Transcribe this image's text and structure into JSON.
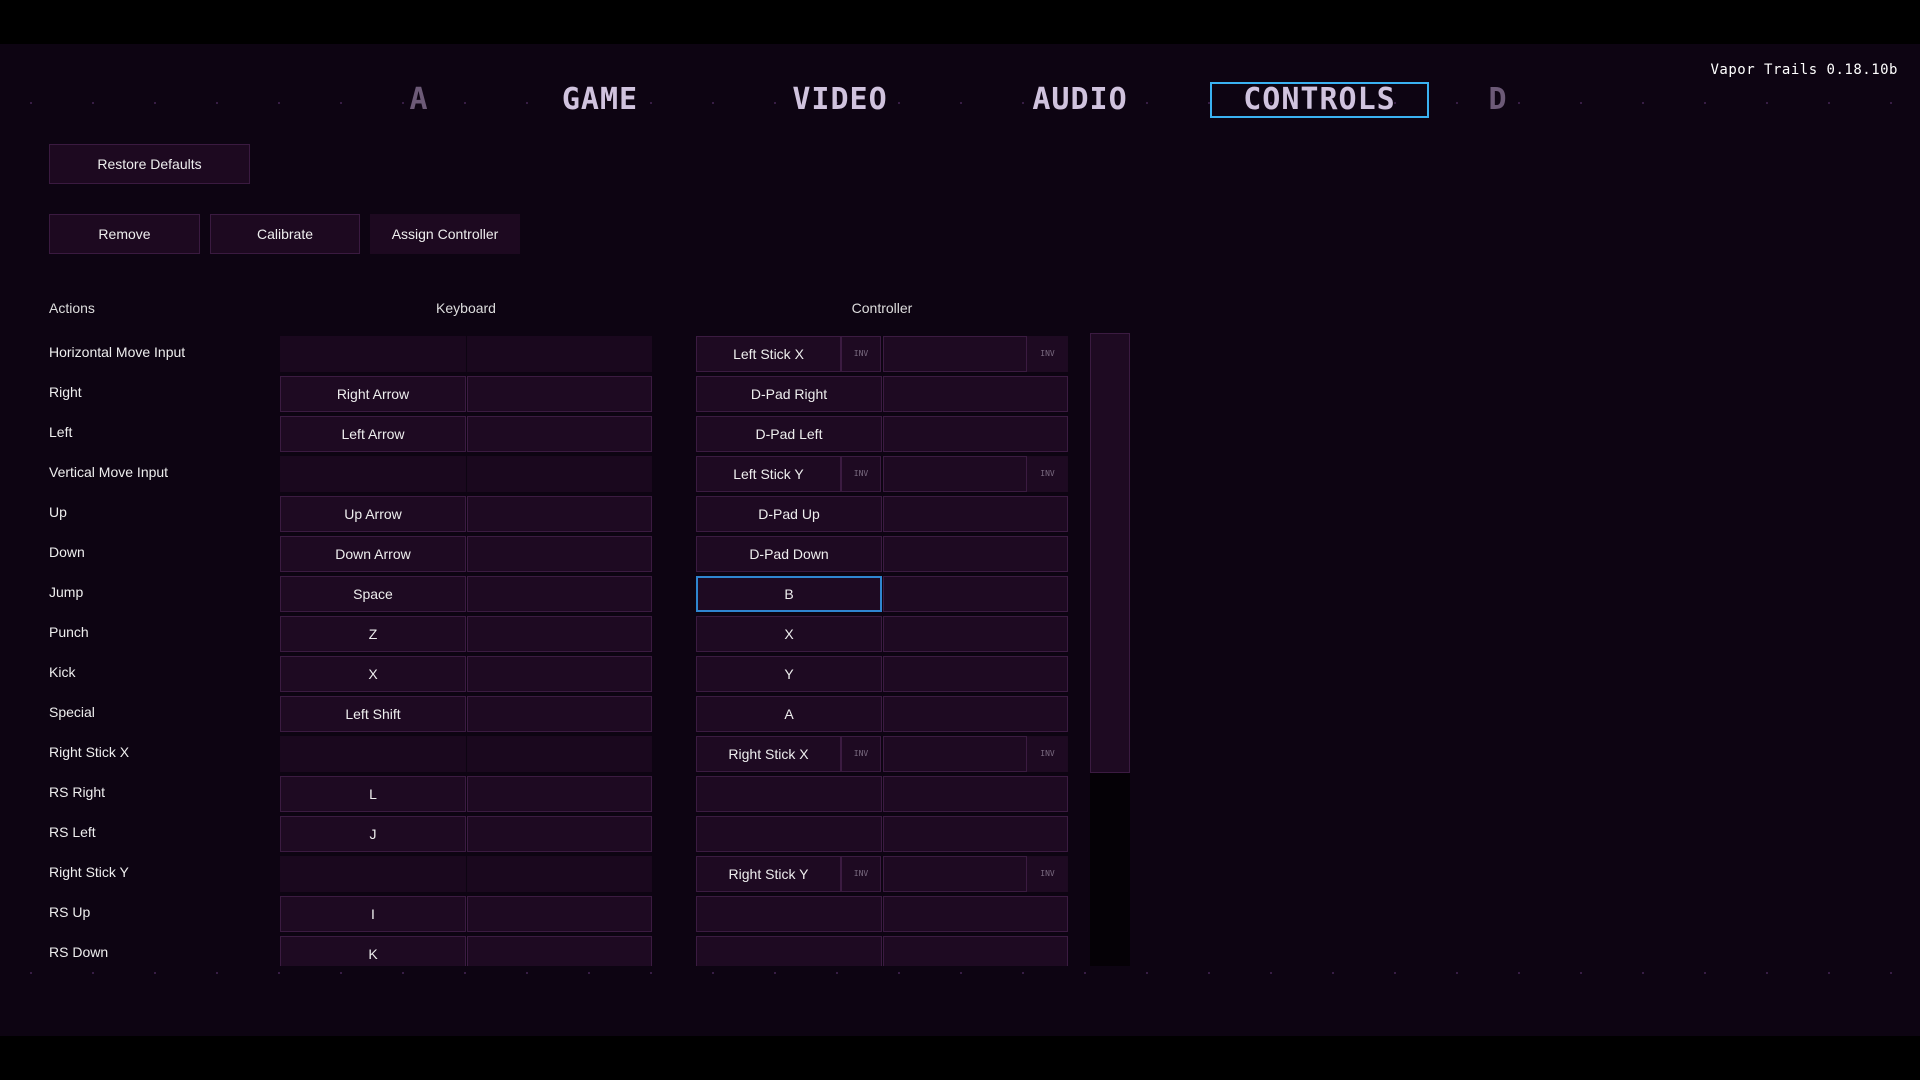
{
  "version": "Vapor Trails 0.18.10b",
  "tabs": [
    {
      "label": "A",
      "state": "dim"
    },
    {
      "label": "GAME",
      "state": "normal"
    },
    {
      "label": "VIDEO",
      "state": "normal"
    },
    {
      "label": "AUDIO",
      "state": "normal"
    },
    {
      "label": "CONTROLS",
      "state": "active"
    },
    {
      "label": "D",
      "state": "dim"
    }
  ],
  "buttons": {
    "restore": "Restore Defaults",
    "remove": "Remove",
    "calibrate": "Calibrate",
    "assign": "Assign Controller"
  },
  "headers": {
    "actions": "Actions",
    "keyboard": "Keyboard",
    "controller": "Controller"
  },
  "inv_label": "INV",
  "colors": {
    "accent": "#3ab2f2",
    "background": "#0d0412",
    "cell": "#1e0a22"
  },
  "scrollbar": {
    "visible_fraction": 0.7,
    "position": 0
  },
  "rows": [
    {
      "action": "Horizontal Move Input",
      "keyboard": [
        "",
        ""
      ],
      "controller": [
        "Left Stick X",
        ""
      ],
      "axis": true
    },
    {
      "action": "Right",
      "keyboard": [
        "Right Arrow",
        ""
      ],
      "controller": [
        "D-Pad Right",
        ""
      ]
    },
    {
      "action": "Left",
      "keyboard": [
        "Left Arrow",
        ""
      ],
      "controller": [
        "D-Pad Left",
        ""
      ]
    },
    {
      "action": "Vertical Move Input",
      "keyboard": [
        "",
        ""
      ],
      "controller": [
        "Left Stick Y",
        ""
      ],
      "axis": true
    },
    {
      "action": "Up",
      "keyboard": [
        "Up Arrow",
        ""
      ],
      "controller": [
        "D-Pad Up",
        ""
      ]
    },
    {
      "action": "Down",
      "keyboard": [
        "Down Arrow",
        ""
      ],
      "controller": [
        "D-Pad Down",
        ""
      ]
    },
    {
      "action": "Jump",
      "keyboard": [
        "Space",
        ""
      ],
      "controller": [
        "B",
        ""
      ],
      "selected": true
    },
    {
      "action": "Punch",
      "keyboard": [
        "Z",
        ""
      ],
      "controller": [
        "X",
        ""
      ]
    },
    {
      "action": "Kick",
      "keyboard": [
        "X",
        ""
      ],
      "controller": [
        "Y",
        ""
      ]
    },
    {
      "action": "Special",
      "keyboard": [
        "Left Shift",
        ""
      ],
      "controller": [
        "A",
        ""
      ]
    },
    {
      "action": "Right Stick X",
      "keyboard": [
        "",
        ""
      ],
      "controller": [
        "Right Stick X",
        ""
      ],
      "axis": true
    },
    {
      "action": "RS Right",
      "keyboard": [
        "L",
        ""
      ],
      "controller": [
        "",
        ""
      ]
    },
    {
      "action": "RS Left",
      "keyboard": [
        "J",
        ""
      ],
      "controller": [
        "",
        ""
      ]
    },
    {
      "action": "Right Stick Y",
      "keyboard": [
        "",
        ""
      ],
      "controller": [
        "Right Stick Y",
        ""
      ],
      "axis": true
    },
    {
      "action": "RS Up",
      "keyboard": [
        "I",
        ""
      ],
      "controller": [
        "",
        ""
      ]
    },
    {
      "action": "RS Down",
      "keyboard": [
        "K",
        ""
      ],
      "controller": [
        "",
        ""
      ]
    }
  ]
}
